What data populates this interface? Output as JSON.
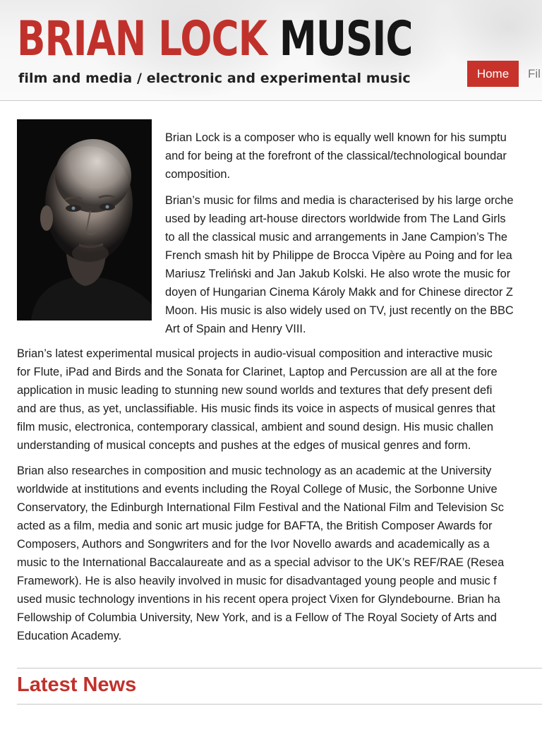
{
  "header": {
    "logo_red": "BRIAN LOCK",
    "logo_black": "MUSIC",
    "tagline": "film and media / electronic and experimental music"
  },
  "nav": {
    "items": [
      {
        "label": "Home",
        "active": true
      },
      {
        "label": "Fil"
      }
    ],
    "accent": "#c7332b"
  },
  "portrait": {
    "alt": "Brian Lock portrait"
  },
  "paragraphs": {
    "p1": [
      "Brian Lock is a composer who is equally well known for his sumptu",
      "and for being at the forefront of the classical/technological boundar",
      "composition."
    ],
    "p2": [
      "Brian’s music for films and media is characterised by his large orche",
      "used by leading art-house directors worldwide from The Land Girls",
      "to all the classical music and arrangements in Jane Campion’s The",
      "French smash hit by Philippe de Brocca Vipère au Poing and for lea",
      "Mariusz Treliński and Jan Jakub Kolski. He also wrote the music for",
      "doyen of Hungarian Cinema Károly Makk and for Chinese director Z",
      "Moon. His music is also widely used on TV, just recently on the BBC",
      "Art of Spain and Henry VIII."
    ],
    "p3": [
      "Brian’s latest experimental musical projects in audio-visual composition and interactive music",
      "for Flute, iPad and Birds and the Sonata for Clarinet, Laptop and Percussion are all at the fore",
      "application in music leading to stunning new sound worlds and textures that defy present defi",
      "and are thus, as yet, unclassifiable. His music finds its voice in aspects of musical genres that",
      "film music, electronica, contemporary classical, ambient and sound design. His music challen",
      "understanding of musical concepts and pushes at the edges of musical genres and form."
    ],
    "p4": [
      "Brian also researches in composition and music technology as an academic at the University",
      "worldwide at institutions and events including the Royal College of Music, the Sorbonne Unive",
      "Conservatory, the Edinburgh International Film Festival and the National Film and Television Sc",
      "acted as a film, media and sonic art music judge for BAFTA, the British Composer Awards for",
      "Composers, Authors and Songwriters and for the Ivor Novello awards and academically as a",
      "music to the International Baccalaureate and as a special advisor to the UK’s REF/RAE (Resea",
      "Framework). He is also heavily involved in music for disadvantaged young people and music f",
      "used music technology inventions in his recent opera project Vixen for Glyndebourne. Brian ha",
      "Fellowship of Columbia University, New York, and is a Fellow of The Royal Society of Arts and",
      "Education Academy."
    ]
  },
  "latest_news": {
    "heading": "Latest News"
  }
}
